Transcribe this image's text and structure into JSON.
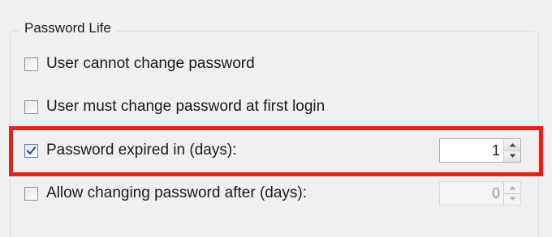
{
  "group": {
    "title": "Password Life"
  },
  "options": {
    "cannot_change": {
      "label": "User cannot change password",
      "checked": false
    },
    "must_change_first_login": {
      "label": "User must change password at first login",
      "checked": false
    },
    "expired_in": {
      "label": "Password expired in (days):",
      "checked": true,
      "value": "1"
    },
    "allow_changing_after": {
      "label": "Allow changing password after (days):",
      "checked": false,
      "value": "0"
    }
  },
  "colors": {
    "highlight": "#e2231a",
    "check_mark": "#2a4f8f"
  },
  "icons": {
    "check": "check-icon",
    "spin_up": "chevron-up-icon",
    "spin_down": "chevron-down-icon"
  }
}
